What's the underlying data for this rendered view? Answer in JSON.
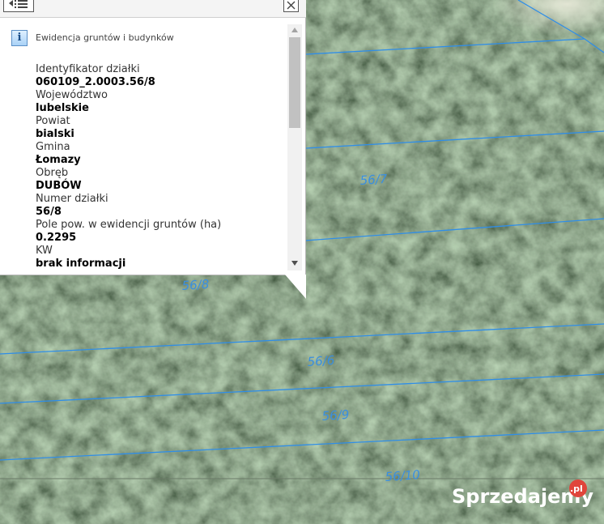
{
  "popup": {
    "header": "Ewidencja gruntów i budynków",
    "attributes": [
      {
        "label": "Identyfikator działki",
        "value": "060109_2.0003.56/8"
      },
      {
        "label": "Województwo",
        "value": "lubelskie"
      },
      {
        "label": "Powiat",
        "value": "bialski"
      },
      {
        "label": "Gmina",
        "value": "Łomazy"
      },
      {
        "label": "Obręb",
        "value": "DUBÓW"
      },
      {
        "label": "Numer działki",
        "value": "56/8"
      },
      {
        "label": "Pole pow. w ewidencji gruntów (ha)",
        "value": "0.2295"
      },
      {
        "label": "KW",
        "value": "brak informacji"
      }
    ],
    "icons": {
      "info": "info-icon",
      "list": "list-icon",
      "close": "close-icon",
      "scroll_up": "arrow-up-icon",
      "scroll_down": "arrow-down-icon"
    }
  },
  "map": {
    "parcel_labels": [
      "56/7",
      "56/8",
      "56/6",
      "56/9",
      "56/10"
    ],
    "boundary_color": "#2f8ee8",
    "label_color": "#3a8fe0"
  },
  "watermark": {
    "text": "Sprzedajemy",
    "suffix": ".pl"
  },
  "colors": {
    "popup_bg": "#ffffff",
    "tree_canopy_dark": "#1f2b1e",
    "tree_canopy_light": "#8fa58a"
  }
}
